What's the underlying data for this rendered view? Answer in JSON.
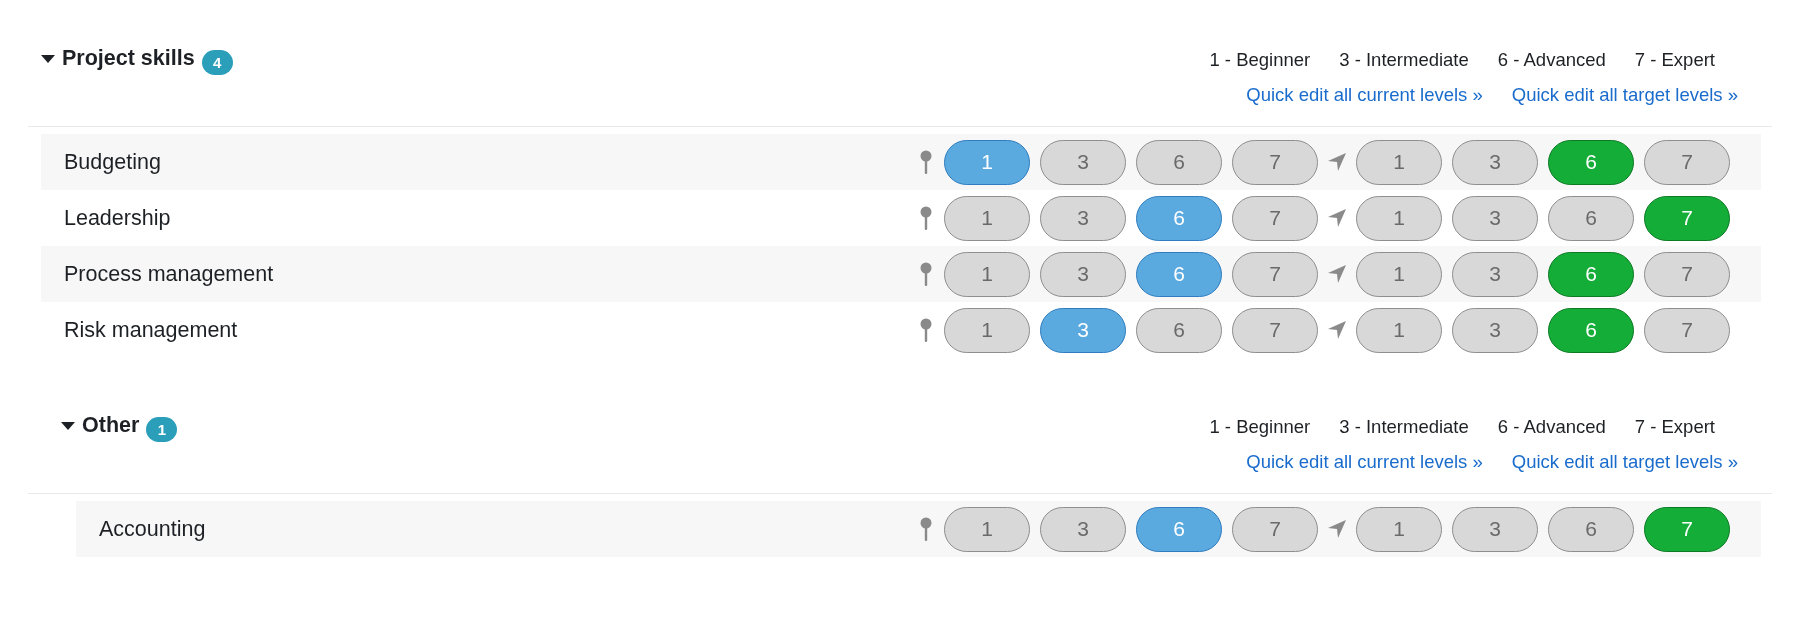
{
  "sections": [
    {
      "title": "Project skills",
      "count": "4",
      "expanded": true,
      "legend": [
        "1 - Beginner",
        "3 - Intermediate",
        "6 - Advanced",
        "7 - Expert"
      ],
      "links": [
        "Quick edit all current levels »",
        "Quick edit all target levels »"
      ],
      "skills": [
        {
          "name": "Budgeting",
          "current": [
            {
              "label": "1",
              "selected": true
            },
            {
              "label": "3",
              "selected": false
            },
            {
              "label": "6",
              "selected": false
            },
            {
              "label": "7",
              "selected": false
            }
          ],
          "target": [
            {
              "label": "1",
              "selected": false
            },
            {
              "label": "3",
              "selected": false
            },
            {
              "label": "6",
              "selected": true
            },
            {
              "label": "7",
              "selected": false
            }
          ]
        },
        {
          "name": "Leadership",
          "current": [
            {
              "label": "1",
              "selected": false
            },
            {
              "label": "3",
              "selected": false
            },
            {
              "label": "6",
              "selected": true
            },
            {
              "label": "7",
              "selected": false
            }
          ],
          "target": [
            {
              "label": "1",
              "selected": false
            },
            {
              "label": "3",
              "selected": false
            },
            {
              "label": "6",
              "selected": false
            },
            {
              "label": "7",
              "selected": true
            }
          ]
        },
        {
          "name": "Process management",
          "current": [
            {
              "label": "1",
              "selected": false
            },
            {
              "label": "3",
              "selected": false
            },
            {
              "label": "6",
              "selected": true
            },
            {
              "label": "7",
              "selected": false
            }
          ],
          "target": [
            {
              "label": "1",
              "selected": false
            },
            {
              "label": "3",
              "selected": false
            },
            {
              "label": "6",
              "selected": true
            },
            {
              "label": "7",
              "selected": false
            }
          ]
        },
        {
          "name": "Risk management",
          "current": [
            {
              "label": "1",
              "selected": false
            },
            {
              "label": "3",
              "selected": true
            },
            {
              "label": "6",
              "selected": false
            },
            {
              "label": "7",
              "selected": false
            }
          ],
          "target": [
            {
              "label": "1",
              "selected": false
            },
            {
              "label": "3",
              "selected": false
            },
            {
              "label": "6",
              "selected": true
            },
            {
              "label": "7",
              "selected": false
            }
          ]
        }
      ]
    },
    {
      "title": "Other",
      "count": "1",
      "expanded": true,
      "legend": [
        "1 - Beginner",
        "3 - Intermediate",
        "6 - Advanced",
        "7 - Expert"
      ],
      "links": [
        "Quick edit all current levels »",
        "Quick edit all target levels »"
      ],
      "skills": [
        {
          "name": "Accounting",
          "current": [
            {
              "label": "1",
              "selected": false
            },
            {
              "label": "3",
              "selected": false
            },
            {
              "label": "6",
              "selected": true
            },
            {
              "label": "7",
              "selected": false
            }
          ],
          "target": [
            {
              "label": "1",
              "selected": false
            },
            {
              "label": "3",
              "selected": false
            },
            {
              "label": "6",
              "selected": false
            },
            {
              "label": "7",
              "selected": true
            }
          ]
        }
      ]
    }
  ]
}
